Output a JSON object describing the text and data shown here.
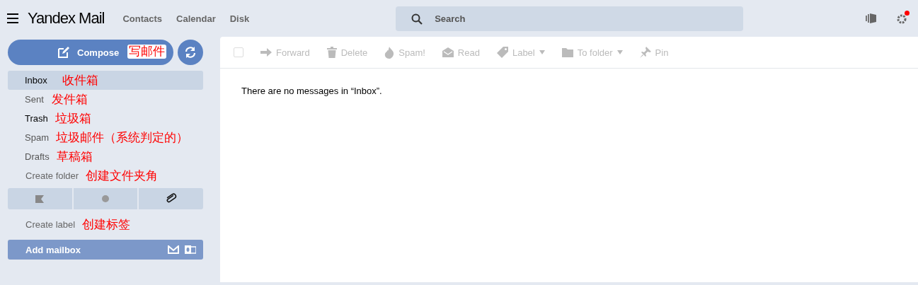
{
  "header": {
    "logo": {
      "brand": "Yandex",
      "product": "Mail"
    },
    "nav": [
      "Contacts",
      "Calendar",
      "Disk"
    ],
    "search": {
      "placeholder": "Search"
    },
    "settings_notification": true
  },
  "compose": {
    "label": "Compose",
    "annotation": "写邮件"
  },
  "folders": [
    {
      "label": "Inbox",
      "annotation": "收件箱",
      "selected": true,
      "unread": true
    },
    {
      "label": "Sent",
      "annotation": "发件箱",
      "selected": false,
      "unread": false
    },
    {
      "label": "Trash",
      "annotation": "垃圾箱",
      "selected": false,
      "unread": true
    },
    {
      "label": "Spam",
      "annotation": "垃圾邮件（系统判定的）",
      "selected": false,
      "unread": false
    },
    {
      "label": "Drafts",
      "annotation": "草稿箱",
      "selected": false,
      "unread": false
    }
  ],
  "create_folder": {
    "label": "Create folder",
    "annotation": "创建文件夹角"
  },
  "filters": [
    {
      "kind": "flag",
      "selected": false
    },
    {
      "kind": "dot",
      "selected": false
    },
    {
      "kind": "clip",
      "selected": false
    }
  ],
  "create_label": {
    "label": "Create label",
    "annotation": "创建标签"
  },
  "add_mailbox": {
    "label": "Add mailbox"
  },
  "toolbar": [
    {
      "kind": "forward",
      "label": "Forward",
      "disabled": true,
      "dropdown": false
    },
    {
      "kind": "delete",
      "label": "Delete",
      "disabled": true,
      "dropdown": false
    },
    {
      "kind": "spam",
      "label": "Spam!",
      "disabled": true,
      "dropdown": false
    },
    {
      "kind": "read",
      "label": "Read",
      "disabled": true,
      "dropdown": false
    },
    {
      "kind": "label",
      "label": "Label",
      "disabled": true,
      "dropdown": true
    },
    {
      "kind": "folder",
      "label": "To folder",
      "disabled": true,
      "dropdown": true
    },
    {
      "kind": "pin",
      "label": "Pin",
      "disabled": true,
      "dropdown": false
    }
  ],
  "select_all": {
    "checked": false
  },
  "empty_message": "There are no messages in “Inbox”."
}
